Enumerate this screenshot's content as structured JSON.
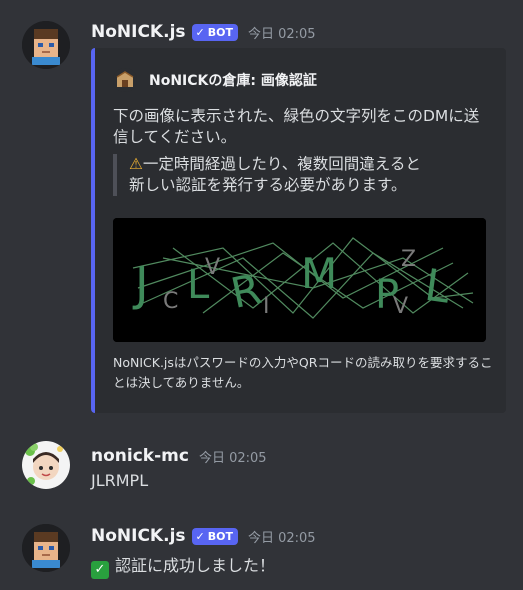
{
  "messages": [
    {
      "author": "NoNICK.js",
      "bot_tag": "BOT",
      "bot_check": "✓",
      "timestamp": "今日 02:05",
      "embed": {
        "author_name": "NoNICKの倉庫: 画像認証",
        "description": "下の画像に表示された、緑色の文字列をこのDMに送信してください。",
        "quote_icon": "warning-icon",
        "quote_line1": "一定時間経過したり、複数回間違えると",
        "quote_line2": "新しい認証を発行する必要があります。",
        "captcha_main_text": "JLRMPL",
        "footer": "NoNICK.jsはパスワードの入力やQRコードの読み取りを要求することは決してありません。",
        "accent_color": "#5865f2"
      }
    },
    {
      "author": "nonick-mc",
      "timestamp": "今日 02:05",
      "content": "JLRMPL"
    },
    {
      "author": "NoNICK.js",
      "bot_tag": "BOT",
      "bot_check": "✓",
      "timestamp": "今日 02:05",
      "content_icon": "white-check-mark-icon",
      "content": "認証に成功しました！"
    }
  ]
}
